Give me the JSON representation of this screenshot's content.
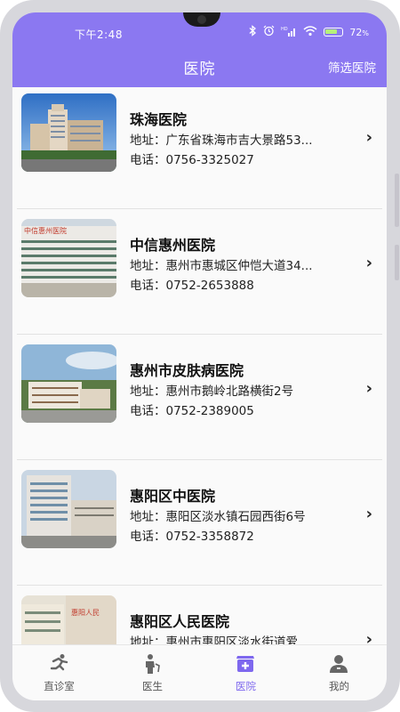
{
  "status_bar": {
    "time": "下午2:48",
    "battery": "72",
    "battery_unit": "%"
  },
  "header": {
    "title": "医院",
    "filter_label": "筛选医院"
  },
  "hospitals": [
    {
      "name": "珠海医院",
      "address": "地址：广东省珠海市吉大景路53...",
      "phone": "电话：0756-3325027"
    },
    {
      "name": "中信惠州医院",
      "address": "地址：惠州市惠城区仲恺大道34...",
      "phone": "电话：0752-2653888"
    },
    {
      "name": "惠州市皮肤病医院",
      "address": "地址：惠州市鹅岭北路横街2号",
      "phone": "电话：0752-2389005"
    },
    {
      "name": "惠阳区中医院",
      "address": "地址：惠阳区淡水镇石园西街6号",
      "phone": "电话：0752-3358872"
    },
    {
      "name": "惠阳区人民医院",
      "address": "地址：惠州市惠阳区淡水街道爱...",
      "phone": ""
    }
  ],
  "tabs": [
    {
      "label": "直诊室",
      "icon": "runner-icon"
    },
    {
      "label": "医生",
      "icon": "doctor-icon"
    },
    {
      "label": "医院",
      "icon": "hospital-icon"
    },
    {
      "label": "我的",
      "icon": "profile-icon"
    }
  ],
  "colors": {
    "accent": "#8b78f1",
    "active_tab": "#7e68ee"
  }
}
